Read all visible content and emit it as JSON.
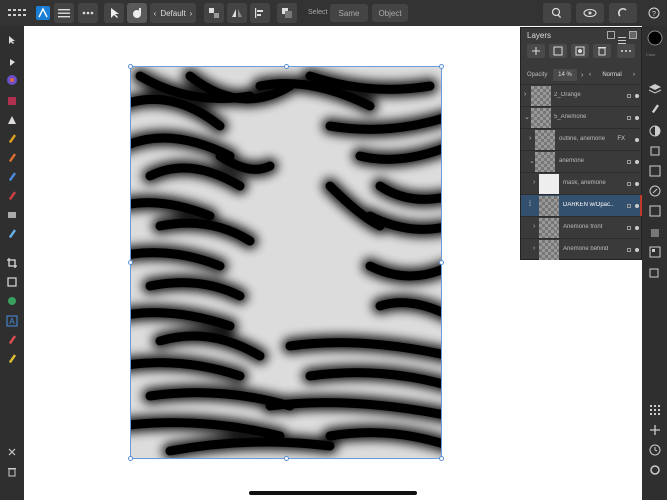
{
  "toolbar": {
    "persona_icons": [
      "grid-icon",
      "affinity-photo-icon",
      "menu-icon",
      "more-icon"
    ],
    "tools": [
      "move-tool-icon",
      "brush-icon"
    ],
    "preset_label": "Default",
    "context_labels": {
      "select": "Select",
      "same": "Same",
      "object": "Object"
    }
  },
  "layers_panel": {
    "title": "Layers",
    "opacity_label": "Opacity",
    "opacity_value": "14 %",
    "blend_mode": "Normal",
    "rows": [
      {
        "name": "2_Orange"
      },
      {
        "name": "5_Anemone"
      },
      {
        "name": "outline, anemone"
      },
      {
        "name": "anemone"
      },
      {
        "name": "mask, anemone"
      },
      {
        "name": "DARKEN w/Opac..."
      },
      {
        "name": "Anemone front"
      },
      {
        "name": "Anemone behind"
      }
    ],
    "fx_label": "FX"
  },
  "right_strip": {
    "color_label": "Color"
  },
  "colors": {
    "accent": "#3a7bd5",
    "selected_layer": "#34506f",
    "canvas_bg": "#ffffff",
    "doc_bg": "#dcdcdc",
    "stroke": "#000000",
    "red_marker": "#c0392b"
  }
}
